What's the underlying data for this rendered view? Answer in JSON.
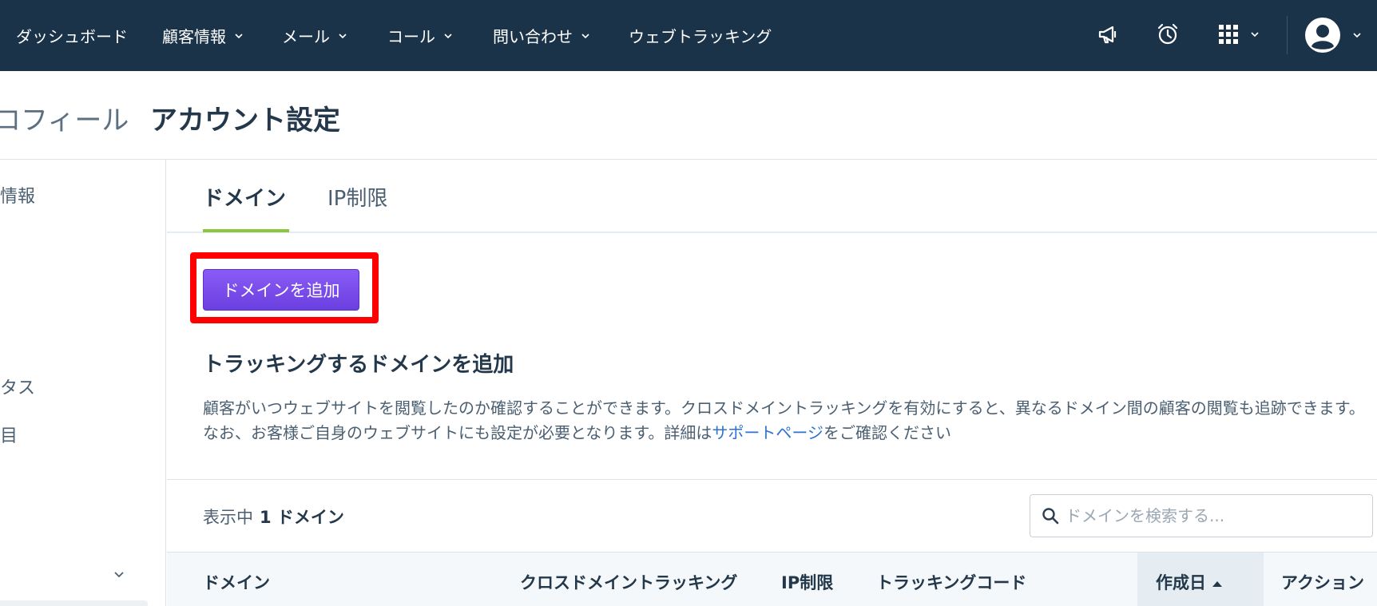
{
  "nav": {
    "items": [
      {
        "label": "ダッシュボード",
        "dropdown": false
      },
      {
        "label": "顧客情報",
        "dropdown": true
      },
      {
        "label": "メール",
        "dropdown": true
      },
      {
        "label": "コール",
        "dropdown": true
      },
      {
        "label": "問い合わせ",
        "dropdown": true
      },
      {
        "label": "ウェブトラッキング",
        "dropdown": false
      }
    ],
    "icons": [
      "megaphone-icon",
      "alarm-clock-icon",
      "apps-grid-icon",
      "user-avatar-icon"
    ]
  },
  "page": {
    "breadcrumb_prev": "ロフィール",
    "title": "アカウント設定"
  },
  "sidebar": {
    "items": [
      "情報",
      "タス",
      "目"
    ]
  },
  "tabs": [
    {
      "label": "ドメイン",
      "active": true
    },
    {
      "label": "IP制限",
      "active": false
    }
  ],
  "content": {
    "add_button_label": "ドメインを追加",
    "heading": "トラッキングするドメインを追加",
    "description_text": "顧客がいつウェブサイトを閲覧したのか確認することができます。クロスドメイントラッキングを有効にすると、異なるドメイン間の顧客の閲覧も追跡できます。なお、お客様ご自身のウェブサイトにも設定が必要となります。詳細は",
    "description_link": "サポートページ",
    "description_suffix": "をご確認ください"
  },
  "list": {
    "showing_label": "表示中",
    "count_text": "1 ドメイン",
    "search_placeholder": "ドメインを検索する..."
  },
  "table": {
    "columns": [
      "ドメイン",
      "クロスドメイントラッキング",
      "IP制限",
      "トラッキングコード",
      "作成日",
      "アクション"
    ],
    "sorted_column": "作成日",
    "sort_direction": "asc"
  },
  "colors": {
    "nav_bg": "#1b3349",
    "accent_purple": "#7c4dff",
    "tab_underline": "#8cc63f",
    "highlight_red": "#ff0000",
    "link_blue": "#2c72d2"
  }
}
